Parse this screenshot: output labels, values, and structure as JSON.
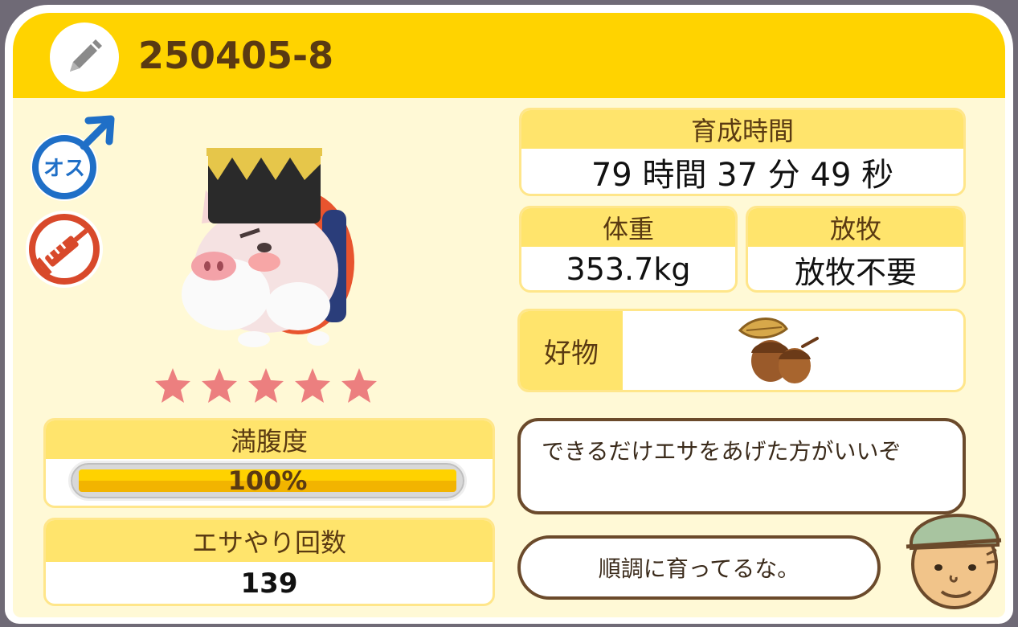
{
  "header": {
    "title": "250405-8",
    "edit_icon": "pencil-icon"
  },
  "status_icons": {
    "sex_label": "オス",
    "sex_icon": "male-symbol-icon",
    "injection_icon": "syringe-icon"
  },
  "rating": {
    "stars": 5,
    "max": 5,
    "color": "#ec7f7f"
  },
  "hunger": {
    "label": "満腹度",
    "value_text": "100%",
    "fill_fraction": 1.0
  },
  "feed_count": {
    "label": "エサやり回数",
    "value": "139"
  },
  "raising_time": {
    "label": "育成時間",
    "value": "79 時間 37 分 49 秒"
  },
  "weight": {
    "label": "体重",
    "value": "353.7kg"
  },
  "grazing": {
    "label": "放牧",
    "value": "放牧不要"
  },
  "favorite": {
    "label": "好物",
    "item_icon": "acorn-icon"
  },
  "dialogue": {
    "line1": "できるだけエサをあげた方がいいぞ",
    "line2": "順調に育ってるな。",
    "speaker_icon": "farmer-face-icon"
  },
  "colors": {
    "header": "#ffd300",
    "label_bg": "#ffe46c",
    "text_brown": "#5a3a12",
    "male_blue": "#1f6fc7",
    "injection_red": "#d8492b"
  }
}
